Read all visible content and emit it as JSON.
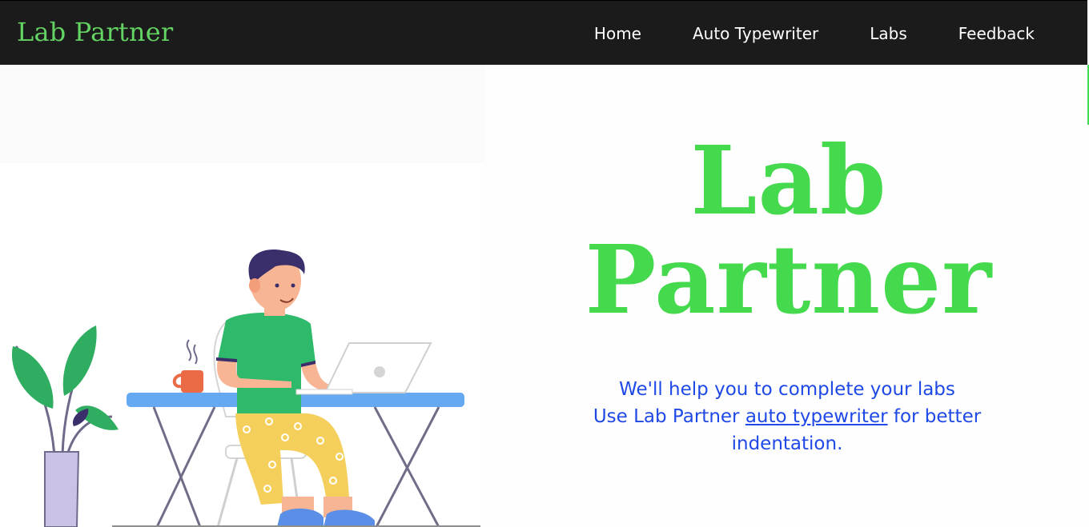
{
  "navbar": {
    "brand": "Lab Partner",
    "links": [
      "Home",
      "Auto Typewriter",
      "Labs",
      "Feedback"
    ]
  },
  "hero": {
    "title_line1": "Lab",
    "title_line2": "Partner",
    "tagline_line1": "We'll help you to complete your labs",
    "tagline_prefix": "Use Lab Partner ",
    "tagline_link": "auto typewriter",
    "tagline_suffix": " for better indentation."
  },
  "colors": {
    "navbar_bg": "#1b1b1b",
    "brand_green": "#63d463",
    "hero_green": "#45d94e",
    "tagline_blue": "#1f49e6"
  },
  "illustration": {
    "description_icon": "person-working-at-laptop-illustration"
  }
}
